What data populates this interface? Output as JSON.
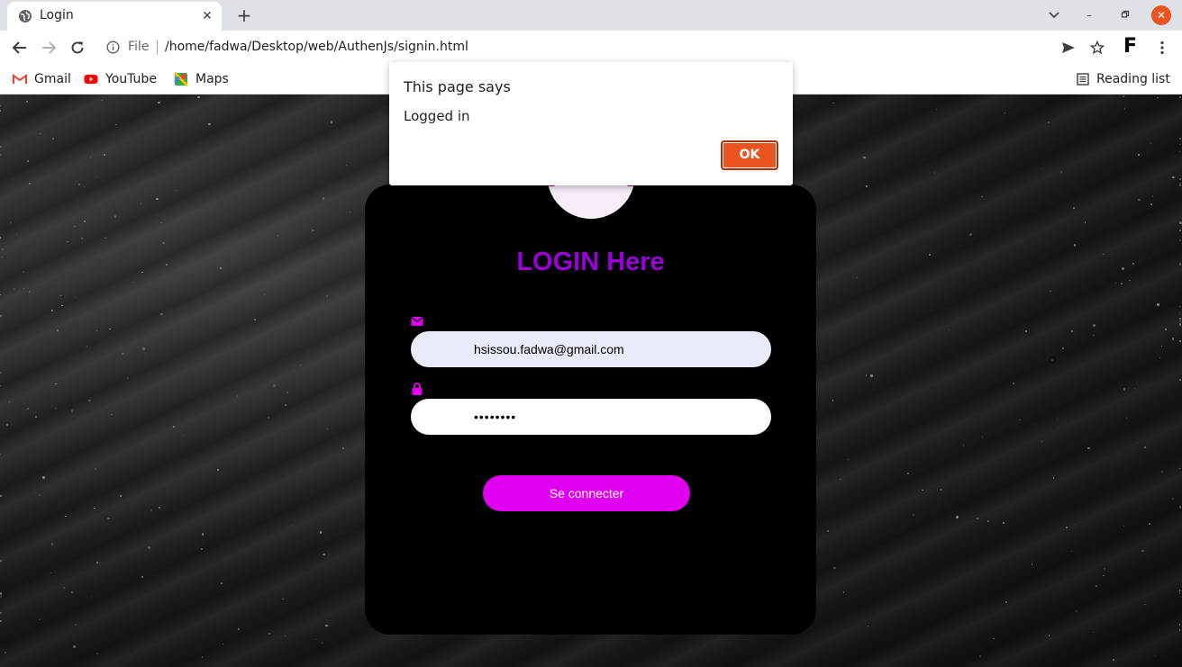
{
  "browser": {
    "tab_title": "Login",
    "file_label": "File",
    "url": "/home/fadwa/Desktop/web/AuthenJs/signin.html",
    "profile_initial": "F",
    "bookmarks": [
      {
        "label": "Gmail",
        "icon": "gmail-icon"
      },
      {
        "label": "YouTube",
        "icon": "youtube-icon"
      },
      {
        "label": "Maps",
        "icon": "maps-icon"
      }
    ],
    "reading_list": "Reading list"
  },
  "login": {
    "title": "LOGIN Here",
    "email_value": "hsissou.fadwa@gmail.com",
    "password_value": "••••••••",
    "submit_label": "Se connecter",
    "accent_color": "#9b00d8",
    "button_color": "#e000f0"
  },
  "dialog": {
    "title": "This page says",
    "message": "Logged in",
    "ok_label": "OK",
    "ok_color": "#e95420"
  }
}
